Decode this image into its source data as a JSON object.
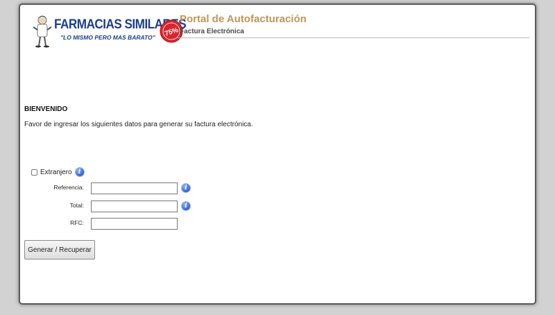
{
  "logo": {
    "brand": "FARMACIAS SIMILARES",
    "slogan": "\"LO MISMO PERO MAS BARATO\"",
    "badge": "75%"
  },
  "header": {
    "title": "Portal de Autofacturación",
    "subtitle": "Factura Electrónica"
  },
  "main": {
    "welcome": "BIENVENIDO",
    "intro": "Favor de ingresar los siguientes datos para generar su factura electrónica.",
    "foreigner_label": "Extranjero",
    "foreigner_checked": false,
    "fields": [
      {
        "label": "Referencia:",
        "value": "",
        "placeholder": ""
      },
      {
        "label": "Total:",
        "value": "",
        "placeholder": ""
      },
      {
        "label": "RFC:",
        "value": "",
        "placeholder": ""
      }
    ],
    "submit_label": "Generar / Recuperar"
  },
  "colors": {
    "title": "#c0955a",
    "brand": "#1d3f8c",
    "badge": "#d8262e",
    "info_icon": "#2f63d6",
    "background": "#d2d2d2"
  },
  "icons": {
    "info": "info-icon",
    "mascot": "doctor-mascot-icon",
    "badge": "discount-badge-icon"
  }
}
